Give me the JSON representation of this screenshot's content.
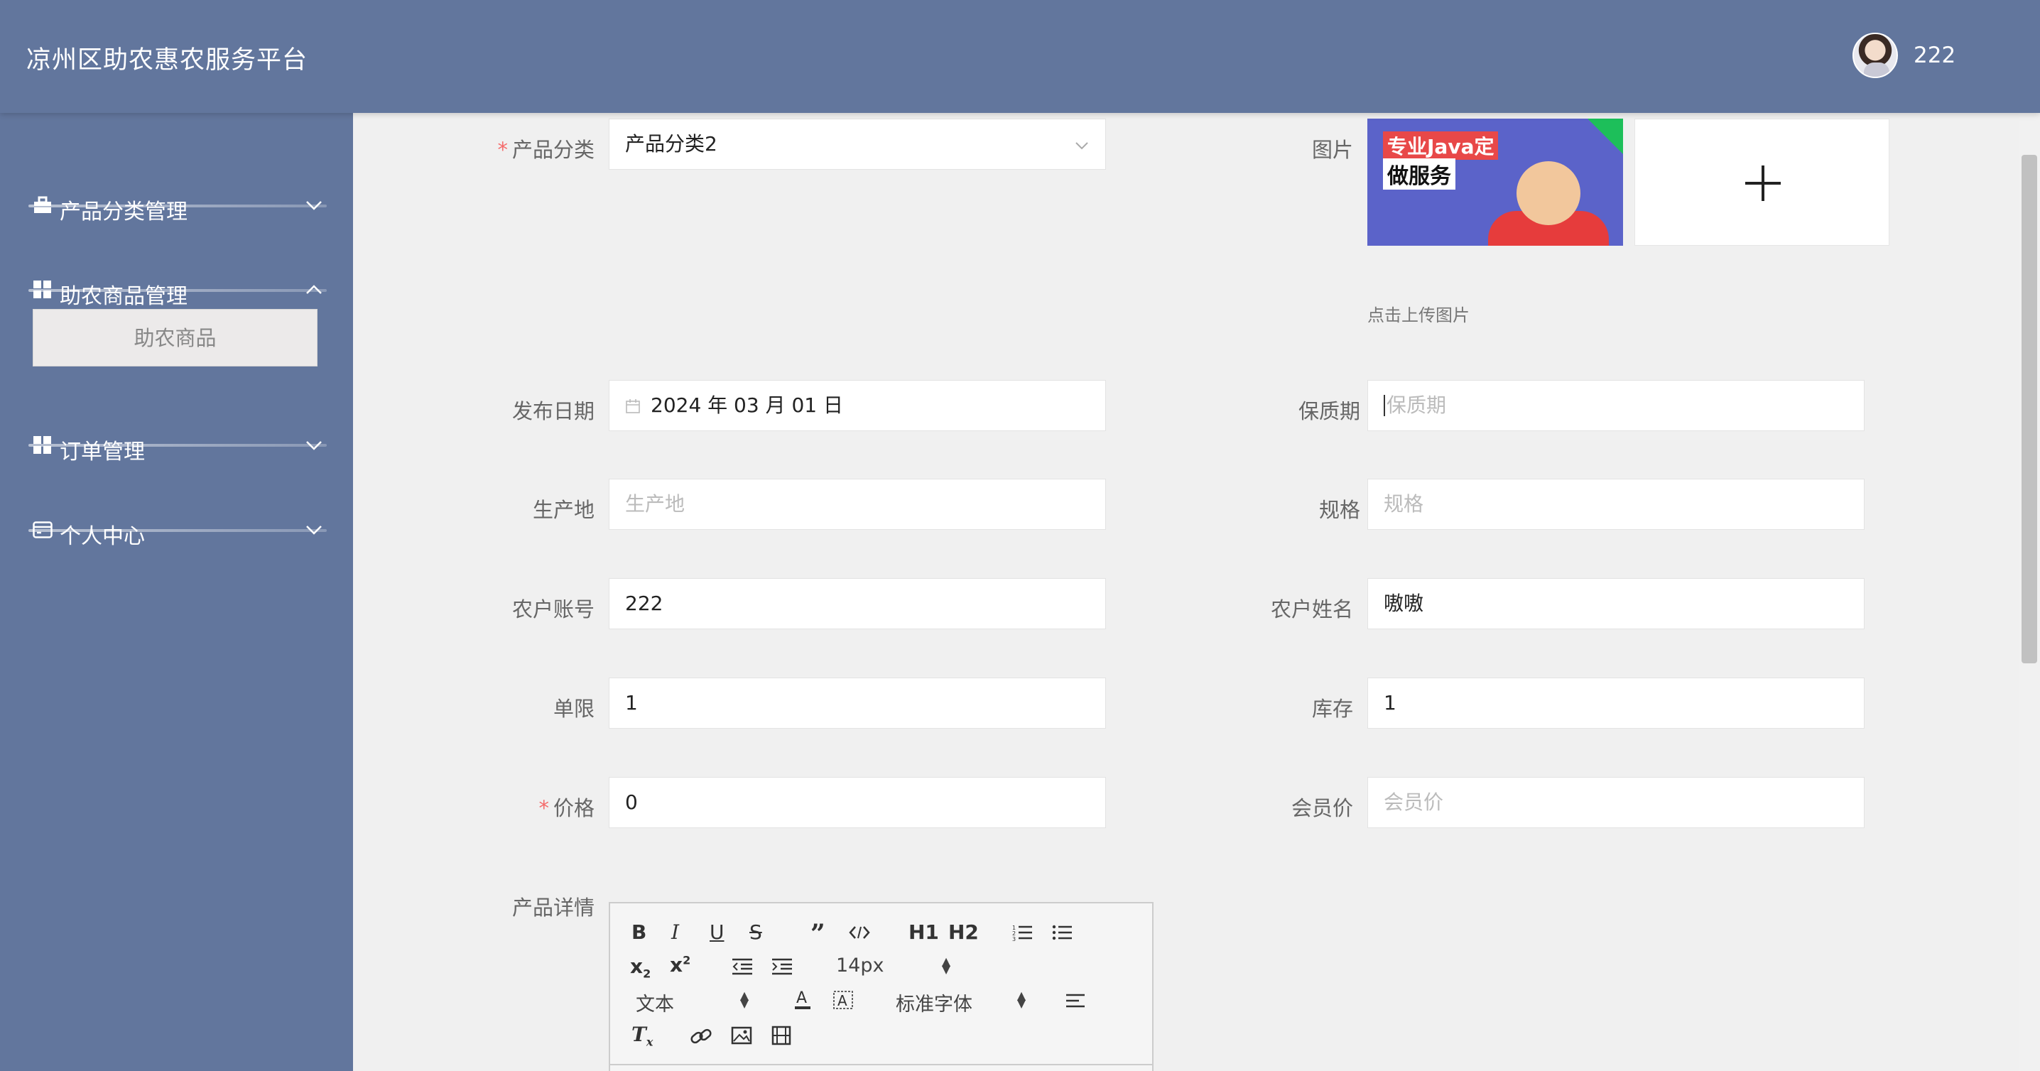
{
  "header": {
    "title": "凉州区助农惠农服务平台",
    "username": "222"
  },
  "sidebar": {
    "items": [
      {
        "label": "产品分类管理",
        "icon": "briefcase-icon",
        "expanded": false
      },
      {
        "label": "助农商品管理",
        "icon": "grid-icon",
        "expanded": true
      },
      {
        "label": "订单管理",
        "icon": "grid-icon",
        "expanded": false
      },
      {
        "label": "个人中心",
        "icon": "card-icon",
        "expanded": false
      }
    ],
    "submenu": {
      "label": "助农商品"
    }
  },
  "form": {
    "category": {
      "label": "产品分类",
      "required": true,
      "value": "产品分类2"
    },
    "image": {
      "label": "图片",
      "hint": "点击上传图片",
      "thumb_line1": "专业Java定",
      "thumb_line2": "做服务"
    },
    "publish_date": {
      "label": "发布日期",
      "value": "2024 年 03 月 01 日"
    },
    "shelf_life": {
      "label": "保质期",
      "placeholder": "保质期"
    },
    "origin": {
      "label": "生产地",
      "placeholder": "生产地"
    },
    "spec": {
      "label": "规格",
      "placeholder": "规格"
    },
    "farmer_account": {
      "label": "农户账号",
      "value": "222"
    },
    "farmer_name": {
      "label": "农户姓名",
      "value": "嗷嗷"
    },
    "limit": {
      "label": "单限",
      "value": "1"
    },
    "stock": {
      "label": "库存",
      "value": "1"
    },
    "price": {
      "label": "价格",
      "required": true,
      "value": "0"
    },
    "member_price": {
      "label": "会员价",
      "placeholder": "会员价"
    },
    "details": {
      "label": "产品详情"
    }
  },
  "editor": {
    "font_size": "14px",
    "header_type": "文本",
    "font_family": "标准字体",
    "h1": "H1",
    "h2": "H2"
  },
  "colors": {
    "header_bg": "#62769d",
    "sidebar_bg": "#62769d",
    "required": "#f56c6c"
  }
}
